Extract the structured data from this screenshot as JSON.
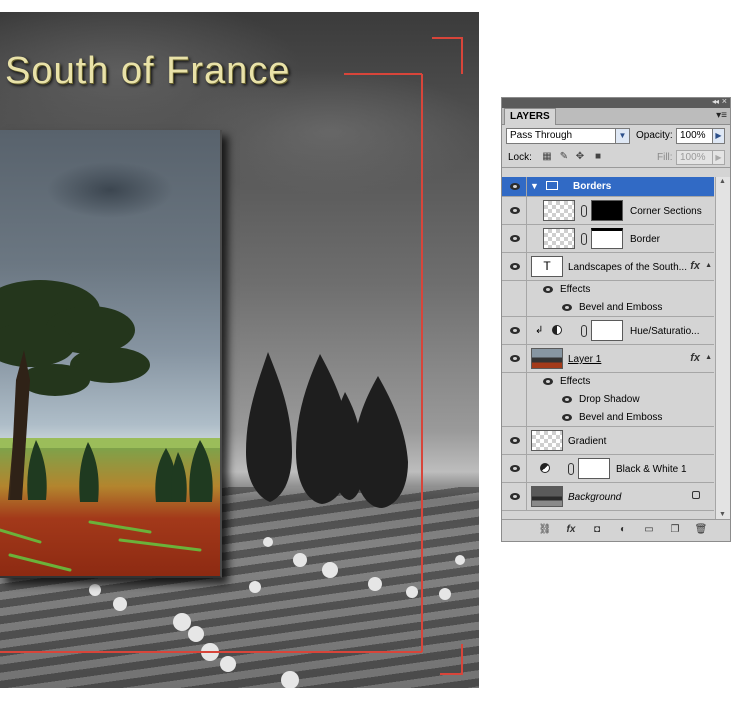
{
  "canvas": {
    "title_text": "South of France",
    "frame_color": "#d8453a"
  },
  "layers_panel": {
    "tab_label": "LAYERS",
    "blend_mode": "Pass Through",
    "opacity_label": "Opacity:",
    "opacity_value": "100%",
    "lock_label": "Lock:",
    "fill_label": "Fill:",
    "fill_value": "100%",
    "layers": {
      "borders": "Borders",
      "corner_sections": "Corner Sections",
      "border": "Border",
      "text_layer": "Landscapes of the South...",
      "text_effects": "Effects",
      "text_bevel": "Bevel and Emboss",
      "hue_sat": "Hue/Saturatio...",
      "layer1": "Layer 1",
      "layer1_effects": "Effects",
      "layer1_shadow": "Drop Shadow",
      "layer1_bevel": "Bevel and Emboss",
      "gradient": "Gradient",
      "bw": "Black & White 1",
      "background": "Background"
    },
    "fx_label": "fx",
    "text_thumb_label": "T",
    "selection_color": "#316ac5"
  }
}
